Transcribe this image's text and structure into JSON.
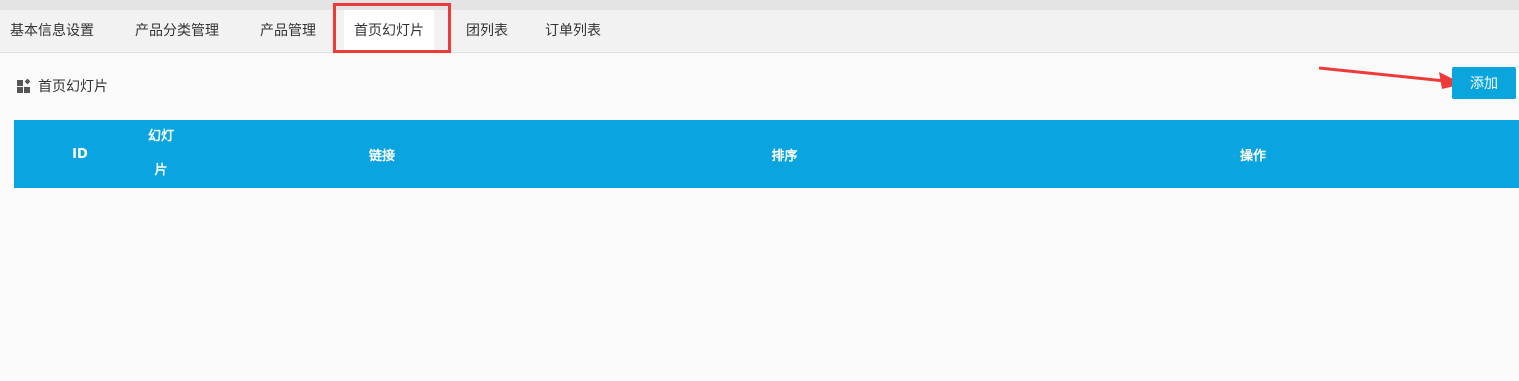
{
  "tabs": [
    {
      "label": "基本信息设置"
    },
    {
      "label": "产品分类管理"
    },
    {
      "label": "产品管理"
    },
    {
      "label": "首页幻灯片"
    },
    {
      "label": "团列表"
    },
    {
      "label": "订单列表"
    }
  ],
  "active_tab": "首页幻灯片",
  "section": {
    "title": "首页幻灯片",
    "icon": "grid-icon"
  },
  "add_button": {
    "label": "添加"
  },
  "table": {
    "headers": [
      "ID",
      "幻灯片",
      "链接",
      "排序",
      "操作"
    ],
    "rows": []
  },
  "colors": {
    "accent": "#0aa5e0",
    "highlight": "#ef3a3a"
  }
}
